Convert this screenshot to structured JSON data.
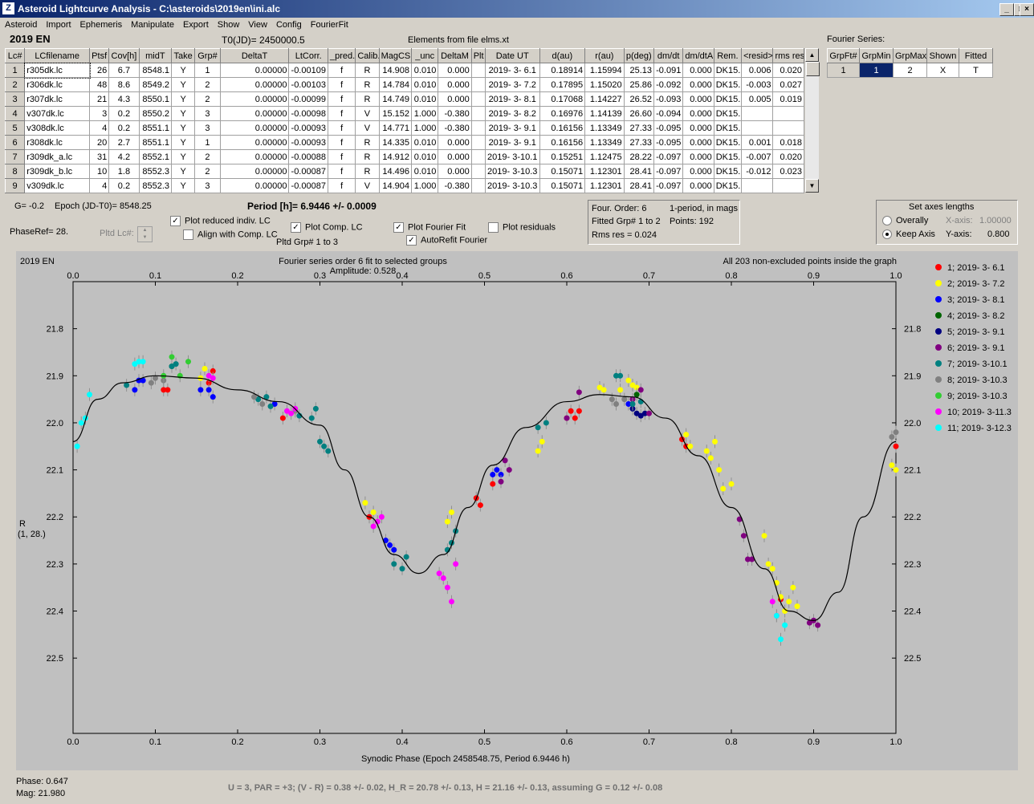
{
  "window": {
    "title": "Asteroid Lightcurve Analysis - C:\\asteroids\\2019en\\ini.alc",
    "app_icon": "ALC"
  },
  "menu": [
    "Asteroid",
    "Import",
    "Ephemeris",
    "Manipulate",
    "Export",
    "Show",
    "View",
    "Config",
    "FourierFit"
  ],
  "header": {
    "object": "2019 EN",
    "t0": "T0(JD)= 2450000.5",
    "elements": "Elements from file elms.xt",
    "fourier_label": "Fourier Series:"
  },
  "lc_table": {
    "columns": [
      "Lc#",
      "LCfilename",
      "Ptsf",
      "Cov[h]",
      "midT",
      "Take",
      "Grp#",
      "DeltaT",
      "LtCorr.",
      "_pred.",
      "Calib.",
      "MagCS",
      "_unc",
      "DeltaM",
      "Plt",
      "Date UT",
      "d(au)",
      "r(au)",
      "p(deg)",
      "dm/dt",
      "dm/dtA",
      "Rem.",
      "<resid>",
      "rms res"
    ],
    "rows": [
      [
        "1",
        "r305dk.lc",
        "26",
        "6.7",
        "8548.1",
        "Y",
        "1",
        "0.00000",
        "-0.00109",
        "f",
        "R",
        "14.908",
        "0.010",
        "0.000",
        "",
        "2019- 3- 6.1",
        "0.18914",
        "1.15994",
        "25.13",
        "-0.091",
        "0.000",
        "DK15..",
        "0.006",
        "0.020"
      ],
      [
        "2",
        "r306dk.lc",
        "48",
        "8.6",
        "8549.2",
        "Y",
        "2",
        "0.00000",
        "-0.00103",
        "f",
        "R",
        "14.784",
        "0.010",
        "0.000",
        "",
        "2019- 3- 7.2",
        "0.17895",
        "1.15020",
        "25.86",
        "-0.092",
        "0.000",
        "DK15..",
        "-0.003",
        "0.027"
      ],
      [
        "3",
        "r307dk.lc",
        "21",
        "4.3",
        "8550.1",
        "Y",
        "2",
        "0.00000",
        "-0.00099",
        "f",
        "R",
        "14.749",
        "0.010",
        "0.000",
        "",
        "2019- 3- 8.1",
        "0.17068",
        "1.14227",
        "26.52",
        "-0.093",
        "0.000",
        "DK15..",
        "0.005",
        "0.019"
      ],
      [
        "4",
        "v307dk.lc",
        "3",
        "0.2",
        "8550.2",
        "Y",
        "3",
        "0.00000",
        "-0.00098",
        "f",
        "V",
        "15.152",
        "1.000",
        "-0.380",
        "",
        "2019- 3- 8.2",
        "0.16976",
        "1.14139",
        "26.60",
        "-0.094",
        "0.000",
        "DK15..",
        "",
        ""
      ],
      [
        "5",
        "v308dk.lc",
        "4",
        "0.2",
        "8551.1",
        "Y",
        "3",
        "0.00000",
        "-0.00093",
        "f",
        "V",
        "14.771",
        "1.000",
        "-0.380",
        "",
        "2019- 3- 9.1",
        "0.16156",
        "1.13349",
        "27.33",
        "-0.095",
        "0.000",
        "DK15..",
        "",
        ""
      ],
      [
        "6",
        "r308dk.lc",
        "20",
        "2.7",
        "8551.1",
        "Y",
        "1",
        "0.00000",
        "-0.00093",
        "f",
        "R",
        "14.335",
        "0.010",
        "0.000",
        "",
        "2019- 3- 9.1",
        "0.16156",
        "1.13349",
        "27.33",
        "-0.095",
        "0.000",
        "DK15..",
        "0.001",
        "0.018"
      ],
      [
        "7",
        "r309dk_a.lc",
        "31",
        "4.2",
        "8552.1",
        "Y",
        "2",
        "0.00000",
        "-0.00088",
        "f",
        "R",
        "14.912",
        "0.010",
        "0.000",
        "",
        "2019- 3-10.1",
        "0.15251",
        "1.12475",
        "28.22",
        "-0.097",
        "0.000",
        "DK15..",
        "-0.007",
        "0.020"
      ],
      [
        "8",
        "r309dk_b.lc",
        "10",
        "1.8",
        "8552.3",
        "Y",
        "2",
        "0.00000",
        "-0.00087",
        "f",
        "R",
        "14.496",
        "0.010",
        "0.000",
        "",
        "2019- 3-10.3",
        "0.15071",
        "1.12301",
        "28.41",
        "-0.097",
        "0.000",
        "DK15..",
        "-0.012",
        "0.023"
      ],
      [
        "9",
        "v309dk.lc",
        "4",
        "0.2",
        "8552.3",
        "Y",
        "3",
        "0.00000",
        "-0.00087",
        "f",
        "V",
        "14.904",
        "1.000",
        "-0.380",
        "",
        "2019- 3-10.3",
        "0.15071",
        "1.12301",
        "28.41",
        "-0.097",
        "0.000",
        "DK15..",
        "",
        ""
      ]
    ]
  },
  "fourier_table": {
    "columns": [
      "GrpFt#",
      "GrpMin",
      "GrpMax",
      "Shown",
      "Fitted"
    ],
    "row": [
      "1",
      "1",
      "2",
      "X",
      "T"
    ]
  },
  "controls": {
    "g": "G= -0.2",
    "epoch": "Epoch (JD-T0)= 8548.25",
    "period": "Period [h]= 6.9446 +/- 0.0009",
    "phaseref": "PhaseRef= 28.",
    "pltd_lc": "Pltd Lc#:",
    "cb_reduced": "Plot reduced indiv. LC",
    "cb_align": "Align with Comp. LC",
    "cb_comp": "Plot Comp. LC",
    "pltd_grp": "Pltd Grp#  1   to   3",
    "cb_fourier": "Plot Fourier Fit",
    "cb_autorefit": "AutoRefit Fourier",
    "cb_resid": "Plot residuals",
    "info1": "Four. Order:  6",
    "info2": "1-period, in mags",
    "info3": "Fitted Grp# 1 to 2",
    "info4": "Points: 192",
    "info5": "Rms res     = 0.024",
    "axes_title": "Set axes lengths",
    "opt_overall": "Overally",
    "opt_keep": "Keep Axis",
    "xaxis_label": "X-axis:",
    "xaxis_val": "1.00000",
    "yaxis_label": "Y-axis:",
    "yaxis_val": "0.800"
  },
  "chart_data": {
    "type": "scatter",
    "object_label": "2019 EN",
    "title": "Fourier series order 6 fit to selected groups",
    "subtitle": "Amplitude: 0.528",
    "note": "All 203 non-excluded points inside the graph",
    "xlabel": "Synodic Phase (Epoch 2458548.75, Period 6.9446 h)",
    "ylabel_line1": "R",
    "ylabel_line2": "(1, 28.)",
    "xlim": [
      0,
      1
    ],
    "ylim": [
      21.7,
      22.66
    ],
    "xticks": [
      "0.0",
      "0.1",
      "0.2",
      "0.3",
      "0.4",
      "0.5",
      "0.6",
      "0.7",
      "0.8",
      "0.9",
      "1.0"
    ],
    "yticks": [
      "21.8",
      "21.9",
      "22.0",
      "22.1",
      "22.2",
      "22.3",
      "22.4",
      "22.5"
    ],
    "legend_placement": "right",
    "fit_curve": {
      "x": [
        0.0,
        0.03,
        0.06,
        0.1,
        0.15,
        0.2,
        0.25,
        0.3,
        0.33,
        0.36,
        0.39,
        0.42,
        0.45,
        0.48,
        0.51,
        0.55,
        0.6,
        0.64,
        0.68,
        0.72,
        0.76,
        0.8,
        0.84,
        0.87,
        0.9,
        0.93,
        0.96,
        1.0
      ],
      "y": [
        22.04,
        21.95,
        21.915,
        21.9,
        21.905,
        21.93,
        21.955,
        22.005,
        22.1,
        22.2,
        22.28,
        22.32,
        22.28,
        22.18,
        22.09,
        22.01,
        21.955,
        21.94,
        21.945,
        21.99,
        22.07,
        22.18,
        22.31,
        22.4,
        22.42,
        22.36,
        22.2,
        22.04
      ]
    },
    "series": [
      {
        "name": "1; 2019- 3- 6.1",
        "color": "#ff0000",
        "points": [
          [
            0.11,
            21.93
          ],
          [
            0.115,
            21.93
          ],
          [
            0.165,
            21.915
          ],
          [
            0.17,
            21.89
          ],
          [
            0.255,
            21.99
          ],
          [
            0.36,
            22.2
          ],
          [
            0.49,
            22.16
          ],
          [
            0.495,
            22.175
          ],
          [
            0.51,
            22.13
          ],
          [
            0.6,
            21.99
          ],
          [
            0.605,
            21.975
          ],
          [
            0.61,
            21.99
          ],
          [
            0.615,
            21.975
          ],
          [
            0.74,
            22.035
          ],
          [
            0.745,
            22.05
          ],
          [
            0.86,
            22.375
          ],
          [
            1.0,
            22.05
          ]
        ]
      },
      {
        "name": "2; 2019- 3- 7.2",
        "color": "#ffff00",
        "points": [
          [
            0.155,
            21.905
          ],
          [
            0.16,
            21.885
          ],
          [
            0.355,
            22.17
          ],
          [
            0.365,
            22.19
          ],
          [
            0.455,
            22.21
          ],
          [
            0.46,
            22.19
          ],
          [
            0.57,
            22.04
          ],
          [
            0.565,
            22.06
          ],
          [
            0.64,
            21.925
          ],
          [
            0.645,
            21.93
          ],
          [
            0.665,
            21.93
          ],
          [
            0.675,
            21.91
          ],
          [
            0.68,
            21.92
          ],
          [
            0.685,
            21.925
          ],
          [
            0.745,
            22.025
          ],
          [
            0.75,
            22.05
          ],
          [
            0.77,
            22.06
          ],
          [
            0.775,
            22.075
          ],
          [
            0.78,
            22.04
          ],
          [
            0.785,
            22.1
          ],
          [
            0.79,
            22.14
          ],
          [
            0.8,
            22.13
          ],
          [
            0.84,
            22.24
          ],
          [
            0.845,
            22.3
          ],
          [
            0.85,
            22.31
          ],
          [
            0.855,
            22.34
          ],
          [
            0.86,
            22.37
          ],
          [
            0.865,
            22.4
          ],
          [
            0.87,
            22.38
          ],
          [
            0.875,
            22.35
          ],
          [
            0.88,
            22.39
          ],
          [
            1.0,
            22.1
          ],
          [
            0.995,
            22.09
          ]
        ]
      },
      {
        "name": "3; 2019- 3- 8.1",
        "color": "#0000ff",
        "points": [
          [
            0.075,
            21.93
          ],
          [
            0.08,
            21.91
          ],
          [
            0.085,
            21.91
          ],
          [
            0.155,
            21.93
          ],
          [
            0.165,
            21.93
          ],
          [
            0.17,
            21.945
          ],
          [
            0.245,
            21.96
          ],
          [
            0.38,
            22.25
          ],
          [
            0.385,
            22.26
          ],
          [
            0.39,
            22.27
          ],
          [
            0.51,
            22.11
          ],
          [
            0.515,
            22.1
          ],
          [
            0.52,
            22.11
          ],
          [
            0.675,
            21.96
          ]
        ]
      },
      {
        "name": "4; 2019- 3- 8.2",
        "color": "#006400",
        "points": [
          [
            0.12,
            21.88
          ],
          [
            0.685,
            21.94
          ]
        ]
      },
      {
        "name": "5; 2019- 3- 9.1",
        "color": "#000080",
        "points": [
          [
            0.68,
            21.97
          ],
          [
            0.685,
            21.98
          ],
          [
            0.69,
            21.985
          ],
          [
            0.695,
            21.98
          ]
        ]
      },
      {
        "name": "6; 2019- 3- 9.1",
        "color": "#800080",
        "points": [
          [
            0.52,
            22.125
          ],
          [
            0.525,
            22.08
          ],
          [
            0.53,
            22.1
          ],
          [
            0.6,
            21.99
          ],
          [
            0.615,
            21.935
          ],
          [
            0.68,
            21.95
          ],
          [
            0.69,
            21.93
          ],
          [
            0.7,
            21.98
          ],
          [
            0.81,
            22.205
          ],
          [
            0.815,
            22.24
          ],
          [
            0.82,
            22.29
          ],
          [
            0.825,
            22.29
          ],
          [
            0.9,
            22.42
          ],
          [
            0.905,
            22.43
          ],
          [
            0.895,
            22.425
          ]
        ]
      },
      {
        "name": "7; 2019- 3-10.1",
        "color": "#008080",
        "points": [
          [
            0.065,
            21.92
          ],
          [
            0.12,
            21.88
          ],
          [
            0.125,
            21.875
          ],
          [
            0.225,
            21.95
          ],
          [
            0.235,
            21.945
          ],
          [
            0.24,
            21.965
          ],
          [
            0.275,
            21.985
          ],
          [
            0.29,
            21.99
          ],
          [
            0.295,
            21.97
          ],
          [
            0.3,
            22.04
          ],
          [
            0.305,
            22.05
          ],
          [
            0.31,
            22.06
          ],
          [
            0.39,
            22.3
          ],
          [
            0.4,
            22.31
          ],
          [
            0.405,
            22.285
          ],
          [
            0.455,
            22.27
          ],
          [
            0.46,
            22.255
          ],
          [
            0.465,
            22.23
          ],
          [
            0.575,
            22.0
          ],
          [
            0.565,
            22.01
          ],
          [
            0.66,
            21.9
          ],
          [
            0.665,
            21.9
          ],
          [
            0.68,
            21.96
          ],
          [
            0.69,
            21.955
          ]
        ]
      },
      {
        "name": "8; 2019- 3-10.3",
        "color": "#808080",
        "points": [
          [
            0.095,
            21.915
          ],
          [
            0.1,
            21.905
          ],
          [
            0.11,
            21.91
          ],
          [
            0.22,
            21.945
          ],
          [
            0.23,
            21.96
          ],
          [
            0.27,
            21.975
          ],
          [
            0.655,
            21.95
          ],
          [
            0.66,
            21.96
          ],
          [
            0.67,
            21.95
          ],
          [
            1.0,
            22.02
          ],
          [
            0.995,
            22.03
          ]
        ]
      },
      {
        "name": "9; 2019- 3-10.3",
        "color": "#32cd32",
        "points": [
          [
            0.11,
            21.9
          ],
          [
            0.12,
            21.86
          ],
          [
            0.13,
            21.9
          ],
          [
            0.14,
            21.87
          ]
        ]
      },
      {
        "name": "10; 2019- 3-11.3",
        "color": "#ff00ff",
        "points": [
          [
            0.165,
            21.9
          ],
          [
            0.17,
            21.905
          ],
          [
            0.26,
            21.975
          ],
          [
            0.265,
            21.98
          ],
          [
            0.27,
            21.97
          ],
          [
            0.365,
            22.22
          ],
          [
            0.37,
            22.21
          ],
          [
            0.375,
            22.2
          ],
          [
            0.445,
            22.32
          ],
          [
            0.45,
            22.33
          ],
          [
            0.455,
            22.35
          ],
          [
            0.46,
            22.38
          ],
          [
            0.465,
            22.3
          ],
          [
            0.85,
            22.38
          ],
          [
            0.855,
            22.41
          ]
        ]
      },
      {
        "name": "11; 2019- 3-12.3",
        "color": "#00ffff",
        "points": [
          [
            0.005,
            22.05
          ],
          [
            0.01,
            22.0
          ],
          [
            0.015,
            21.99
          ],
          [
            0.02,
            21.94
          ],
          [
            0.075,
            21.875
          ],
          [
            0.08,
            21.87
          ],
          [
            0.085,
            21.87
          ],
          [
            0.855,
            22.41
          ],
          [
            0.86,
            22.46
          ],
          [
            0.865,
            22.43
          ]
        ]
      }
    ]
  },
  "footer": {
    "phase": "Phase:  0.647",
    "mag": "Mag:    21.980",
    "result": "U = 3, PAR = +3; (V - R) = 0.38 +/- 0.02, H_R = 20.78 +/- 0.13, H = 21.16 +/- 0.13, assuming G = 0.12 +/- 0.08"
  }
}
